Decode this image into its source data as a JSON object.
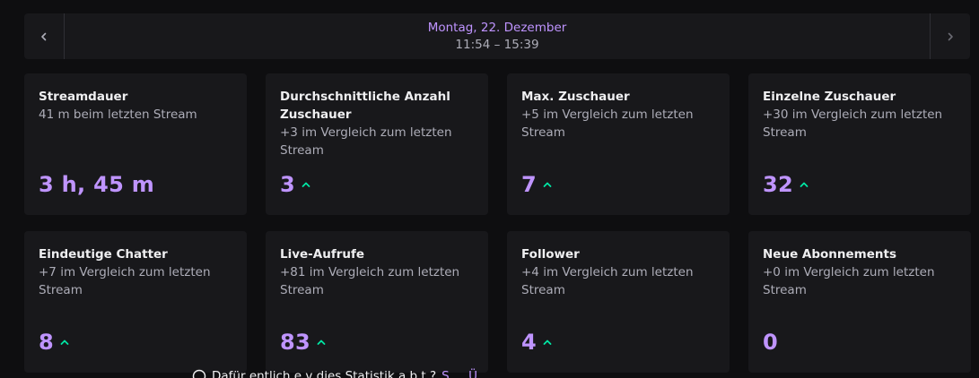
{
  "nav": {
    "date": "Montag, 22. Dezember",
    "time": "11:54 – 15:39",
    "prev_icon": "chevron-left-icon",
    "next_icon": "chevron-right-icon"
  },
  "cards": [
    {
      "title": "Streamdauer",
      "subtitle": "41 m beim letzten Stream",
      "value": "3 h, 45 m",
      "trend": "none"
    },
    {
      "title": "Durchschnittliche Anzahl Zuschauer",
      "subtitle": "+3 im Vergleich zum letzten Stream",
      "value": "3",
      "trend": "up"
    },
    {
      "title": "Max. Zuschauer",
      "subtitle": "+5 im Vergleich zum letzten Stream",
      "value": "7",
      "trend": "up"
    },
    {
      "title": "Einzelne Zuschauer",
      "subtitle": "+30 im Vergleich zum letzten Stream",
      "value": "32",
      "trend": "up"
    },
    {
      "title": "Eindeutige Chatter",
      "subtitle": "+7 im Vergleich zum letzten Stream",
      "value": "8",
      "trend": "up"
    },
    {
      "title": "Live-Aufrufe",
      "subtitle": "+81 im Vergleich zum letzten Stream",
      "value": "83",
      "trend": "up"
    },
    {
      "title": "Follower",
      "subtitle": "+4 im Vergleich zum letzten Stream",
      "value": "4",
      "trend": "up"
    },
    {
      "title": "Neue Abonnements",
      "subtitle": "+0 im Vergleich zum letzten Stream",
      "value": "0",
      "trend": "none"
    }
  ],
  "footer": {
    "text": "Dafür entlich e v dies Statistik a b t ?",
    "link": "S ... Ü ..."
  },
  "colors": {
    "background": "#0e0e10",
    "card": "#18181b",
    "accent": "#bf94ff",
    "trend_up": "#00e6a4",
    "muted": "#adadb8"
  }
}
